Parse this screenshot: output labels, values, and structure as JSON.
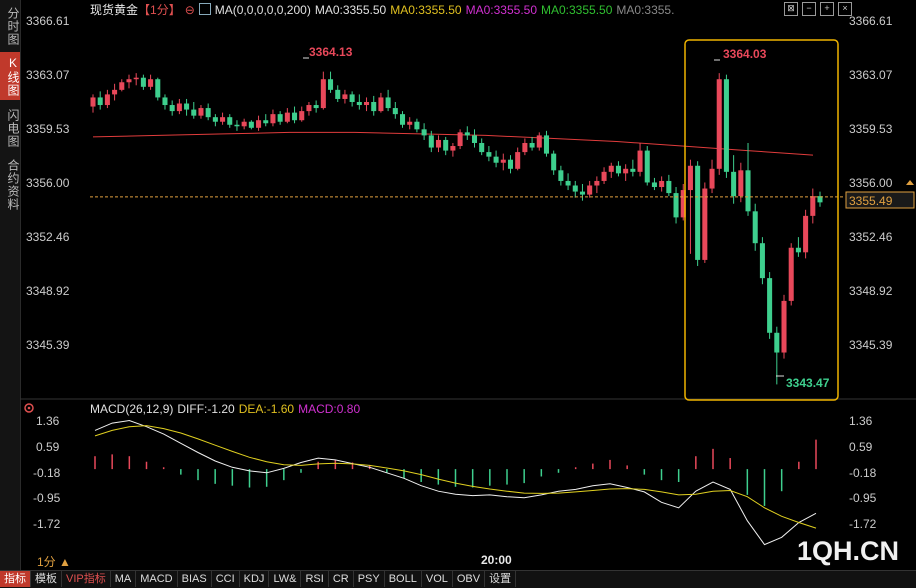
{
  "left_tabs": [
    "分时图",
    "K线图",
    "闪电图",
    "合约资料"
  ],
  "header": {
    "symbol": "现货黄金",
    "period": "【1分】",
    "ma_params": "MA(0,0,0,0,0,200)",
    "ma_items": [
      {
        "text": "MA0:3355.50",
        "color": "#e0e0e0"
      },
      {
        "text": "MA0:3355.50",
        "color": "#e0c020"
      },
      {
        "text": "MA0:3355.50",
        "color": "#d030d0"
      },
      {
        "text": "MA0:3355.50",
        "color": "#30c030"
      },
      {
        "text": "MA0:3355.",
        "color": "#888888"
      }
    ]
  },
  "toolbar_icons": [
    "expand-icon",
    "minus-icon",
    "plus-icon",
    "close-icon"
  ],
  "price_axis": {
    "labels": [
      "3366.61",
      "3363.07",
      "3359.53",
      "3356.00",
      "3352.46",
      "3348.92",
      "3345.39"
    ],
    "current": "3355.49",
    "ref_line": 3355.85
  },
  "price_annotations": {
    "high1": "3364.13",
    "high2": "3364.03",
    "low": "3343.47"
  },
  "macd_header": {
    "params": "MACD(26,12,9)",
    "diff": "DIFF:-1.20",
    "dea": "DEA:-1.60",
    "macd": "MACD:0.80"
  },
  "macd_axis": {
    "labels": [
      "1.36",
      "0.59",
      "-0.18",
      "-0.95",
      "-1.72"
    ]
  },
  "time_label": "20:00",
  "period_indicator": "1分 ▲",
  "watermark": "1QH.CN",
  "bottom_tabs": [
    "指标",
    "模板",
    "VIP指标",
    "MA",
    "MACD",
    "BIAS",
    "CCI",
    "KDJ",
    "LW&",
    "RSI",
    "CR",
    "PSY",
    "BOLL",
    "VOL",
    "OBV",
    "设置"
  ],
  "colors": {
    "up": "#e8485a",
    "down": "#3ecf8e",
    "ma200": "#e03c3c",
    "highlight": "#f0b400"
  },
  "chart_data": {
    "type": "candlestick",
    "price_ylim": [
      3343.0,
      3367.5
    ],
    "candles": [
      [
        3361.8,
        3362.6,
        3361.4,
        3362.4
      ],
      [
        3362.4,
        3362.8,
        3361.6,
        3361.9
      ],
      [
        3361.9,
        3362.9,
        3361.7,
        3362.6
      ],
      [
        3362.6,
        3363.3,
        3362.2,
        3362.9
      ],
      [
        3362.9,
        3363.6,
        3362.8,
        3363.4
      ],
      [
        3363.4,
        3363.9,
        3363.0,
        3363.6
      ],
      [
        3363.6,
        3364.0,
        3363.2,
        3363.7
      ],
      [
        3363.7,
        3363.9,
        3362.9,
        3363.1
      ],
      [
        3363.1,
        3363.9,
        3362.9,
        3363.6
      ],
      [
        3363.6,
        3363.7,
        3362.2,
        3362.4
      ],
      [
        3362.4,
        3362.6,
        3361.6,
        3361.9
      ],
      [
        3361.9,
        3362.2,
        3361.2,
        3361.5
      ],
      [
        3361.5,
        3362.3,
        3361.3,
        3362.0
      ],
      [
        3362.0,
        3362.3,
        3361.2,
        3361.6
      ],
      [
        3361.6,
        3362.1,
        3361.0,
        3361.2
      ],
      [
        3361.2,
        3361.9,
        3361.0,
        3361.7
      ],
      [
        3361.7,
        3362.0,
        3360.9,
        3361.1
      ],
      [
        3361.1,
        3361.3,
        3360.5,
        3360.8
      ],
      [
        3360.8,
        3361.4,
        3360.6,
        3361.1
      ],
      [
        3361.1,
        3361.3,
        3360.4,
        3360.6
      ],
      [
        3360.6,
        3360.9,
        3360.2,
        3360.5
      ],
      [
        3360.5,
        3361.0,
        3360.3,
        3360.8
      ],
      [
        3360.8,
        3360.9,
        3360.3,
        3360.4
      ],
      [
        3360.4,
        3361.2,
        3360.2,
        3360.9
      ],
      [
        3360.9,
        3361.3,
        3360.5,
        3360.7
      ],
      [
        3360.7,
        3361.6,
        3360.5,
        3361.3
      ],
      [
        3361.3,
        3361.5,
        3360.6,
        3360.8
      ],
      [
        3360.8,
        3361.7,
        3360.7,
        3361.4
      ],
      [
        3361.4,
        3361.8,
        3360.7,
        3360.9
      ],
      [
        3360.9,
        3361.8,
        3360.8,
        3361.5
      ],
      [
        3361.5,
        3362.1,
        3361.2,
        3361.9
      ],
      [
        3361.9,
        3362.2,
        3361.4,
        3361.7
      ],
      [
        3361.7,
        3364.1,
        3361.6,
        3363.6
      ],
      [
        3363.6,
        3364.1,
        3362.7,
        3362.9
      ],
      [
        3362.9,
        3363.2,
        3362.1,
        3362.3
      ],
      [
        3362.3,
        3362.9,
        3362.0,
        3362.6
      ],
      [
        3362.6,
        3362.8,
        3361.8,
        3362.1
      ],
      [
        3362.1,
        3362.6,
        3361.6,
        3361.9
      ],
      [
        3361.9,
        3362.4,
        3361.5,
        3362.1
      ],
      [
        3362.1,
        3362.5,
        3361.2,
        3361.5
      ],
      [
        3361.5,
        3362.7,
        3361.4,
        3362.4
      ],
      [
        3362.4,
        3362.9,
        3361.5,
        3361.7
      ],
      [
        3361.7,
        3362.1,
        3361.0,
        3361.3
      ],
      [
        3361.3,
        3361.5,
        3360.4,
        3360.6
      ],
      [
        3360.6,
        3361.1,
        3360.3,
        3360.8
      ],
      [
        3360.8,
        3361.0,
        3360.1,
        3360.3
      ],
      [
        3360.3,
        3360.7,
        3359.6,
        3359.9
      ],
      [
        3359.9,
        3360.2,
        3358.8,
        3359.1
      ],
      [
        3359.1,
        3359.9,
        3358.8,
        3359.6
      ],
      [
        3359.6,
        3359.8,
        3358.6,
        3358.9
      ],
      [
        3358.9,
        3359.4,
        3358.5,
        3359.2
      ],
      [
        3359.2,
        3360.3,
        3359.0,
        3360.1
      ],
      [
        3360.1,
        3360.5,
        3359.6,
        3359.9
      ],
      [
        3359.9,
        3360.3,
        3359.1,
        3359.4
      ],
      [
        3359.4,
        3359.7,
        3358.6,
        3358.8
      ],
      [
        3358.8,
        3359.2,
        3358.2,
        3358.5
      ],
      [
        3358.5,
        3358.9,
        3357.8,
        3358.1
      ],
      [
        3358.1,
        3358.7,
        3357.6,
        3358.3
      ],
      [
        3358.3,
        3358.6,
        3357.4,
        3357.7
      ],
      [
        3357.7,
        3359.1,
        3357.6,
        3358.8
      ],
      [
        3358.8,
        3359.7,
        3358.6,
        3359.4
      ],
      [
        3359.4,
        3359.8,
        3358.9,
        3359.1
      ],
      [
        3359.1,
        3360.1,
        3358.9,
        3359.9
      ],
      [
        3359.9,
        3360.2,
        3358.5,
        3358.7
      ],
      [
        3358.7,
        3358.9,
        3357.3,
        3357.6
      ],
      [
        3357.6,
        3357.9,
        3356.6,
        3356.9
      ],
      [
        3356.9,
        3357.4,
        3356.3,
        3356.6
      ],
      [
        3356.6,
        3356.9,
        3355.8,
        3356.2
      ],
      [
        3356.2,
        3356.7,
        3355.6,
        3356.0
      ],
      [
        3356.0,
        3356.9,
        3355.8,
        3356.6
      ],
      [
        3356.6,
        3357.2,
        3356.1,
        3356.9
      ],
      [
        3356.9,
        3357.8,
        3356.7,
        3357.5
      ],
      [
        3357.5,
        3358.1,
        3357.1,
        3357.9
      ],
      [
        3357.9,
        3358.2,
        3357.2,
        3357.4
      ],
      [
        3357.4,
        3358.0,
        3356.9,
        3357.7
      ],
      [
        3357.7,
        3358.3,
        3357.2,
        3357.5
      ],
      [
        3357.5,
        3359.4,
        3357.2,
        3358.9
      ],
      [
        3358.9,
        3359.2,
        3356.6,
        3356.8
      ],
      [
        3356.8,
        3357.1,
        3356.3,
        3356.5
      ],
      [
        3356.5,
        3357.2,
        3356.2,
        3356.9
      ],
      [
        3356.9,
        3357.3,
        3355.9,
        3356.1
      ],
      [
        3356.1,
        3356.5,
        3354.1,
        3354.5
      ],
      [
        3354.5,
        3356.7,
        3354.3,
        3356.3
      ],
      [
        3356.3,
        3358.3,
        3352.1,
        3357.9
      ],
      [
        3357.9,
        3358.2,
        3351.3,
        3351.7
      ],
      [
        3351.7,
        3356.8,
        3351.5,
        3356.4
      ],
      [
        3356.4,
        3358.3,
        3356.1,
        3357.7
      ],
      [
        3357.7,
        3364.0,
        3357.3,
        3363.6
      ],
      [
        3363.6,
        3363.9,
        3357.1,
        3357.5
      ],
      [
        3357.5,
        3358.6,
        3355.4,
        3355.9
      ],
      [
        3355.9,
        3358.1,
        3355.5,
        3357.6
      ],
      [
        3357.6,
        3359.4,
        3354.6,
        3354.9
      ],
      [
        3354.9,
        3355.4,
        3352.3,
        3352.8
      ],
      [
        3352.8,
        3353.2,
        3350.1,
        3350.5
      ],
      [
        3350.5,
        3350.9,
        3346.5,
        3346.9
      ],
      [
        3346.9,
        3347.3,
        3343.5,
        3345.6
      ],
      [
        3345.6,
        3349.4,
        3345.2,
        3349.0
      ],
      [
        3349.0,
        3352.8,
        3348.7,
        3352.5
      ],
      [
        3352.5,
        3353.2,
        3351.9,
        3352.2
      ],
      [
        3352.2,
        3355.0,
        3351.8,
        3354.6
      ],
      [
        3354.6,
        3356.4,
        3354.1,
        3355.9
      ],
      [
        3355.9,
        3356.2,
        3355.2,
        3355.49
      ]
    ],
    "ma200": [
      3359.8,
      3359.9,
      3360.0,
      3360.1,
      3360.1,
      3360.0,
      3359.9,
      3359.7,
      3359.5,
      3359.2,
      3358.9,
      3358.6
    ],
    "macd": {
      "ylim": [
        -2.25,
        1.55
      ],
      "diff": [
        1.05,
        1.25,
        1.32,
        1.15,
        0.95,
        0.7,
        0.45,
        0.22,
        0.05,
        -0.05,
        -0.1,
        0.02,
        0.18,
        0.3,
        0.25,
        0.15,
        0.05,
        -0.1,
        -0.25,
        -0.45,
        -0.6,
        -0.68,
        -0.72,
        -0.7,
        -0.75,
        -0.78,
        -0.7,
        -0.6,
        -0.55,
        -0.45,
        -0.4,
        -0.5,
        -0.62,
        -0.9,
        -1.05,
        -0.6,
        -0.35,
        -0.55,
        -1.4,
        -2.05,
        -1.85,
        -1.45,
        -1.2
      ],
      "dea": [
        0.9,
        1.05,
        1.15,
        1.18,
        1.1,
        0.98,
        0.82,
        0.65,
        0.48,
        0.32,
        0.2,
        0.12,
        0.1,
        0.14,
        0.16,
        0.14,
        0.1,
        0.03,
        -0.05,
        -0.15,
        -0.27,
        -0.38,
        -0.47,
        -0.54,
        -0.6,
        -0.65,
        -0.66,
        -0.65,
        -0.62,
        -0.58,
        -0.54,
        -0.53,
        -0.55,
        -0.62,
        -0.7,
        -0.68,
        -0.6,
        -0.58,
        -0.75,
        -1.05,
        -1.28,
        -1.45,
        -1.6
      ],
      "hist": [
        0.35,
        0.4,
        0.35,
        0.2,
        0.05,
        -0.15,
        -0.3,
        -0.4,
        -0.45,
        -0.5,
        -0.48,
        -0.3,
        -0.1,
        0.2,
        0.25,
        0.18,
        0.1,
        -0.1,
        -0.25,
        -0.35,
        -0.42,
        -0.48,
        -0.5,
        -0.45,
        -0.42,
        -0.38,
        -0.2,
        -0.1,
        0.05,
        0.15,
        0.25,
        0.1,
        -0.15,
        -0.3,
        -0.35,
        0.35,
        0.55,
        0.3,
        -0.7,
        -1.0,
        -0.6,
        0.2,
        0.8
      ]
    }
  }
}
